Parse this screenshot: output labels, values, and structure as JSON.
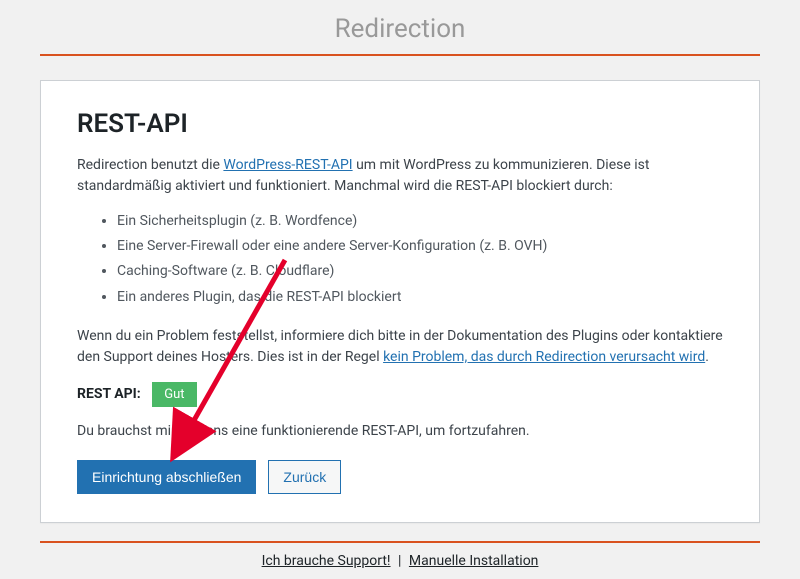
{
  "header": {
    "title": "Redirection"
  },
  "card": {
    "heading": "REST-API",
    "intro_before": "Redirection benutzt die ",
    "intro_link": "WordPress-REST-API",
    "intro_after": " um mit WordPress zu kommunizieren. Diese ist standardmäßig aktiviert und funktioniert. Manchmal wird die REST-API blockiert durch:",
    "bullets": [
      "Ein Sicherheitsplugin (z. B. Wordfence)",
      "Eine Server-Firewall oder eine andere Server-Konfiguration (z. B. OVH)",
      "Caching-Software (z. B. Cloudflare)",
      "Ein anderes Plugin, das die REST-API blockiert"
    ],
    "problem_before": "Wenn du ein Problem feststellst, informiere dich bitte in der Dokumentation des Plugins oder kontaktiere den Support deines Hosters. Dies ist in der Regel ",
    "problem_link": "kein Problem, das durch Redirection verursacht wird",
    "problem_after": ".",
    "status_label": "REST API:",
    "status_value": "Gut",
    "requirement": "Du brauchst mindestens eine funktionierende REST-API, um fortzufahren.",
    "finish_button": "Einrichtung abschließen",
    "back_button": "Zurück"
  },
  "footer": {
    "support": "Ich brauche Support!",
    "separator": " | ",
    "manual": "Manuelle Installation"
  }
}
